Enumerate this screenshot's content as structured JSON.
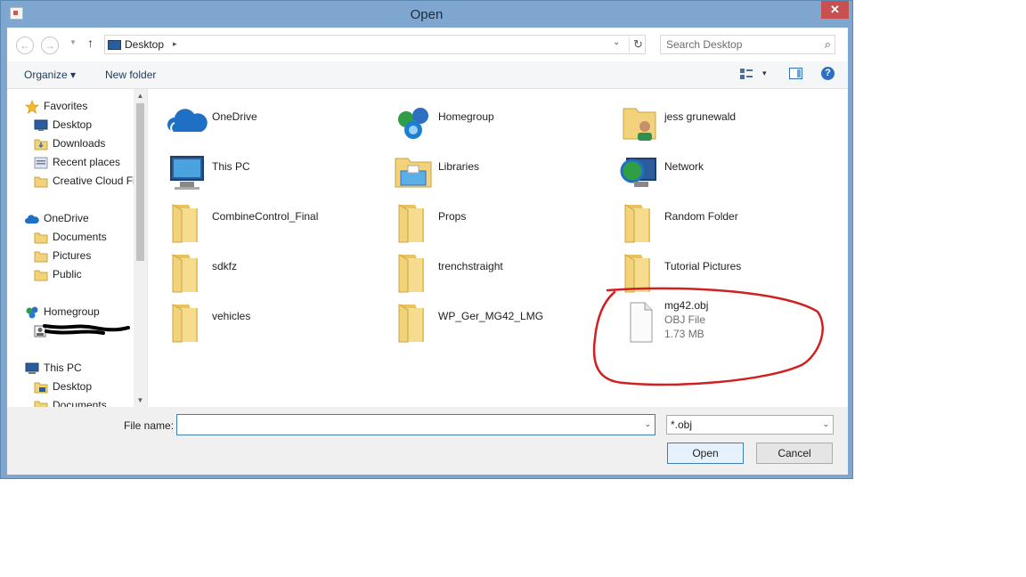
{
  "window": {
    "title": "Open",
    "close_glyph": "✕"
  },
  "nav": {
    "back_glyph": "←",
    "forward_glyph": "→",
    "up_glyph": "↑",
    "address": {
      "location": "Desktop",
      "separator": "▸",
      "dropdown": "⌄",
      "refresh": "↻"
    },
    "search": {
      "placeholder": "Search Desktop",
      "icon": "⌕"
    }
  },
  "toolbar": {
    "organize_label": "Organize ▾",
    "new_folder_label": "New folder",
    "views_dropdown": "▾",
    "help_glyph": "?"
  },
  "sidebar": {
    "items": [
      {
        "label": "Favorites",
        "icon": "star-icon"
      },
      {
        "label": "Desktop",
        "icon": "desktop-icon"
      },
      {
        "label": "Downloads",
        "icon": "downloads-icon"
      },
      {
        "label": "Recent places",
        "icon": "recent-places-icon"
      },
      {
        "label": "Creative Cloud Fi",
        "icon": "folder-icon"
      },
      {
        "label": "OneDrive",
        "icon": "onedrive-icon"
      },
      {
        "label": "Documents",
        "icon": "folder-icon"
      },
      {
        "label": "Pictures",
        "icon": "folder-icon"
      },
      {
        "label": "Public",
        "icon": "folder-icon"
      },
      {
        "label": "Homegroup",
        "icon": "homegroup-icon"
      },
      {
        "label": "",
        "icon": "user-icon"
      },
      {
        "label": "This PC",
        "icon": "this-pc-icon"
      },
      {
        "label": "Desktop",
        "icon": "desktop-icon"
      },
      {
        "label": "Documents",
        "icon": "folder-icon"
      }
    ],
    "scroll_up": "▲",
    "scroll_down": "▼"
  },
  "files": [
    {
      "name": "OneDrive",
      "icon": "onedrive-icon"
    },
    {
      "name": "Homegroup",
      "icon": "homegroup-icon"
    },
    {
      "name": "jess grunewald",
      "icon": "user-folder-icon"
    },
    {
      "name": "This PC",
      "icon": "this-pc-icon"
    },
    {
      "name": "Libraries",
      "icon": "libraries-icon"
    },
    {
      "name": "Network",
      "icon": "network-icon"
    },
    {
      "name": "CombineControl_Final",
      "icon": "folder-icon"
    },
    {
      "name": "Props",
      "icon": "folder-icon"
    },
    {
      "name": "Random Folder",
      "icon": "folder-icon"
    },
    {
      "name": "sdkfz",
      "icon": "folder-icon"
    },
    {
      "name": "trenchstraight",
      "icon": "folder-icon"
    },
    {
      "name": "Tutorial Pictures",
      "icon": "folder-icon"
    },
    {
      "name": "vehicles",
      "icon": "folder-icon"
    },
    {
      "name": "WP_Ger_MG42_LMG",
      "icon": "folder-icon"
    },
    {
      "name": "mg42.obj",
      "type": "OBJ File",
      "size": "1.73 MB",
      "icon": "file-icon"
    }
  ],
  "footer": {
    "file_name_label": "File name:",
    "file_name_value": "",
    "dropdown": "⌄",
    "filter": "*.obj",
    "open_label": "Open",
    "cancel_label": "Cancel"
  },
  "colors": {
    "accent": "#3c7fb1",
    "annotation": "#d02020",
    "frame": "#7ea6ce",
    "folder": "#f2d27a"
  }
}
